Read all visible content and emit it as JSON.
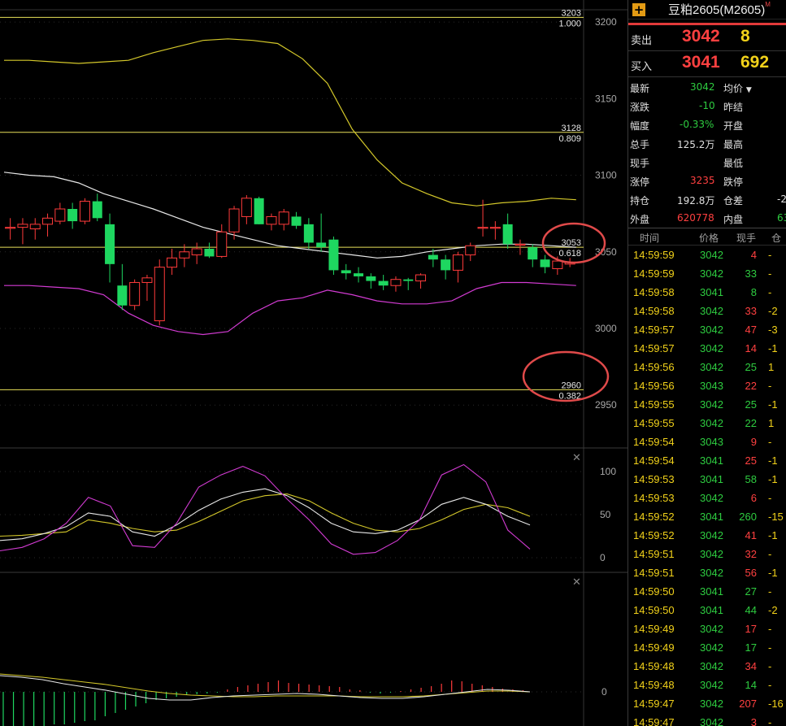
{
  "instrument": {
    "title": "豆粕2605(M2605)",
    "superscript": "M"
  },
  "bid_ask": {
    "sell": {
      "label": "卖出",
      "price": "3042",
      "volume": "8"
    },
    "buy": {
      "label": "买入",
      "price": "3041",
      "volume": "692"
    }
  },
  "stats": {
    "last": {
      "label": "最新",
      "value": "3042"
    },
    "avg_label": "均价",
    "change": {
      "label": "涨跌",
      "value": "-10"
    },
    "prev_settle_label": "昨结",
    "pct": {
      "label": "幅度",
      "value": "-0.33%"
    },
    "open_label": "开盘",
    "volume": {
      "label": "总手",
      "value": "125.2万"
    },
    "high_label": "最高",
    "current_label": "现手",
    "low_label": "最低",
    "limit_up": {
      "label": "涨停",
      "value": "3235"
    },
    "limit_down_label": "跌停",
    "open_interest": {
      "label": "持仓",
      "value": "192.8万"
    },
    "oi_diff": {
      "label": "仓差",
      "value": "-2"
    },
    "outer": {
      "label": "外盘",
      "value": "620778"
    },
    "inner": {
      "label": "内盘",
      "value": "63"
    }
  },
  "ticks_header": {
    "time": "时间",
    "price": "价格",
    "vol": "现手",
    "oi": "仓"
  },
  "ticks": [
    {
      "time": "14:59:59",
      "price": "3042",
      "price_color": "green",
      "vol": "4",
      "vol_color": "red",
      "oi": "-"
    },
    {
      "time": "14:59:59",
      "price": "3042",
      "price_color": "green",
      "vol": "33",
      "vol_color": "green",
      "oi": "-"
    },
    {
      "time": "14:59:58",
      "price": "3041",
      "price_color": "green",
      "vol": "8",
      "vol_color": "green",
      "oi": "-"
    },
    {
      "time": "14:59:58",
      "price": "3042",
      "price_color": "green",
      "vol": "33",
      "vol_color": "red",
      "oi": "-2"
    },
    {
      "time": "14:59:57",
      "price": "3042",
      "price_color": "green",
      "vol": "47",
      "vol_color": "red",
      "oi": "-3"
    },
    {
      "time": "14:59:57",
      "price": "3042",
      "price_color": "green",
      "vol": "14",
      "vol_color": "red",
      "oi": "-1"
    },
    {
      "time": "14:59:56",
      "price": "3042",
      "price_color": "green",
      "vol": "25",
      "vol_color": "green",
      "oi": "1"
    },
    {
      "time": "14:59:56",
      "price": "3043",
      "price_color": "green",
      "vol": "22",
      "vol_color": "red",
      "oi": "-"
    },
    {
      "time": "14:59:55",
      "price": "3042",
      "price_color": "green",
      "vol": "25",
      "vol_color": "green",
      "oi": "-1"
    },
    {
      "time": "14:59:55",
      "price": "3042",
      "price_color": "green",
      "vol": "22",
      "vol_color": "green",
      "oi": "1"
    },
    {
      "time": "14:59:54",
      "price": "3043",
      "price_color": "green",
      "vol": "9",
      "vol_color": "red",
      "oi": "-"
    },
    {
      "time": "14:59:54",
      "price": "3041",
      "price_color": "green",
      "vol": "25",
      "vol_color": "red",
      "oi": "-1"
    },
    {
      "time": "14:59:53",
      "price": "3041",
      "price_color": "green",
      "vol": "58",
      "vol_color": "green",
      "oi": "-1"
    },
    {
      "time": "14:59:53",
      "price": "3042",
      "price_color": "green",
      "vol": "6",
      "vol_color": "red",
      "oi": "-"
    },
    {
      "time": "14:59:52",
      "price": "3041",
      "price_color": "green",
      "vol": "260",
      "vol_color": "green",
      "oi": "-15"
    },
    {
      "time": "14:59:52",
      "price": "3042",
      "price_color": "green",
      "vol": "41",
      "vol_color": "red",
      "oi": "-1"
    },
    {
      "time": "14:59:51",
      "price": "3042",
      "price_color": "green",
      "vol": "32",
      "vol_color": "red",
      "oi": "-"
    },
    {
      "time": "14:59:51",
      "price": "3042",
      "price_color": "green",
      "vol": "56",
      "vol_color": "red",
      "oi": "-1"
    },
    {
      "time": "14:59:50",
      "price": "3041",
      "price_color": "green",
      "vol": "27",
      "vol_color": "green",
      "oi": "-"
    },
    {
      "time": "14:59:50",
      "price": "3041",
      "price_color": "green",
      "vol": "44",
      "vol_color": "green",
      "oi": "-2"
    },
    {
      "time": "14:59:49",
      "price": "3042",
      "price_color": "green",
      "vol": "17",
      "vol_color": "red",
      "oi": "-"
    },
    {
      "time": "14:59:49",
      "price": "3042",
      "price_color": "green",
      "vol": "17",
      "vol_color": "green",
      "oi": "-"
    },
    {
      "time": "14:59:48",
      "price": "3042",
      "price_color": "green",
      "vol": "34",
      "vol_color": "red",
      "oi": "-"
    },
    {
      "time": "14:59:48",
      "price": "3042",
      "price_color": "green",
      "vol": "14",
      "vol_color": "green",
      "oi": "-"
    },
    {
      "time": "14:59:47",
      "price": "3042",
      "price_color": "green",
      "vol": "207",
      "vol_color": "red",
      "oi": "-16"
    },
    {
      "time": "14:59:47",
      "price": "3042",
      "price_color": "green",
      "vol": "3",
      "vol_color": "red",
      "oi": "-"
    }
  ],
  "chart_data": {
    "type": "candlestick",
    "price_axis": {
      "ticks": [
        3200,
        3150,
        3100,
        3050,
        3000,
        2950
      ],
      "range": [
        2922,
        3208
      ]
    },
    "fib_levels": [
      {
        "price": "3203",
        "ratio": "1.000"
      },
      {
        "price": "3128",
        "ratio": "0.809"
      },
      {
        "price": "3053",
        "ratio": "0.618"
      },
      {
        "price": "2960",
        "ratio": "0.382"
      }
    ],
    "candles": [
      {
        "o": 3066,
        "h": 3072,
        "l": 3058,
        "c": 3066
      },
      {
        "o": 3066,
        "h": 3072,
        "l": 3055,
        "c": 3068
      },
      {
        "o": 3065,
        "h": 3072,
        "l": 3058,
        "c": 3068
      },
      {
        "o": 3068,
        "h": 3075,
        "l": 3060,
        "c": 3072
      },
      {
        "o": 3070,
        "h": 3082,
        "l": 3068,
        "c": 3078
      },
      {
        "o": 3078,
        "h": 3082,
        "l": 3065,
        "c": 3070
      },
      {
        "o": 3070,
        "h": 3085,
        "l": 3068,
        "c": 3083
      },
      {
        "o": 3083,
        "h": 3088,
        "l": 3070,
        "c": 3072
      },
      {
        "o": 3068,
        "h": 3075,
        "l": 3030,
        "c": 3042
      },
      {
        "o": 3028,
        "h": 3042,
        "l": 3012,
        "c": 3015
      },
      {
        "o": 3015,
        "h": 3032,
        "l": 3012,
        "c": 3030
      },
      {
        "o": 3030,
        "h": 3035,
        "l": 3018,
        "c": 3033
      },
      {
        "o": 3005,
        "h": 3045,
        "l": 3002,
        "c": 3040
      },
      {
        "o": 3040,
        "h": 3052,
        "l": 3035,
        "c": 3046
      },
      {
        "o": 3046,
        "h": 3055,
        "l": 3040,
        "c": 3050
      },
      {
        "o": 3048,
        "h": 3056,
        "l": 3042,
        "c": 3052
      },
      {
        "o": 3052,
        "h": 3056,
        "l": 3046,
        "c": 3047
      },
      {
        "o": 3047,
        "h": 3068,
        "l": 3046,
        "c": 3063
      },
      {
        "o": 3063,
        "h": 3080,
        "l": 3058,
        "c": 3078
      },
      {
        "o": 3073,
        "h": 3087,
        "l": 3068,
        "c": 3085
      },
      {
        "o": 3085,
        "h": 3086,
        "l": 3068,
        "c": 3068
      },
      {
        "o": 3068,
        "h": 3075,
        "l": 3064,
        "c": 3073
      },
      {
        "o": 3068,
        "h": 3078,
        "l": 3064,
        "c": 3076
      },
      {
        "o": 3073,
        "h": 3076,
        "l": 3065,
        "c": 3067
      },
      {
        "o": 3068,
        "h": 3072,
        "l": 3052,
        "c": 3056
      },
      {
        "o": 3056,
        "h": 3075,
        "l": 3050,
        "c": 3053
      },
      {
        "o": 3058,
        "h": 3060,
        "l": 3035,
        "c": 3038
      },
      {
        "o": 3038,
        "h": 3042,
        "l": 3032,
        "c": 3036
      },
      {
        "o": 3036,
        "h": 3040,
        "l": 3030,
        "c": 3034
      },
      {
        "o": 3034,
        "h": 3036,
        "l": 3026,
        "c": 3031
      },
      {
        "o": 3031,
        "h": 3035,
        "l": 3025,
        "c": 3028
      },
      {
        "o": 3028,
        "h": 3034,
        "l": 3024,
        "c": 3032
      },
      {
        "o": 3032,
        "h": 3033,
        "l": 3025,
        "c": 3031
      },
      {
        "o": 3031,
        "h": 3036,
        "l": 3026,
        "c": 3035
      },
      {
        "o": 3048,
        "h": 3052,
        "l": 3040,
        "c": 3045
      },
      {
        "o": 3045,
        "h": 3048,
        "l": 3032,
        "c": 3038
      },
      {
        "o": 3038,
        "h": 3050,
        "l": 3030,
        "c": 3048
      },
      {
        "o": 3048,
        "h": 3056,
        "l": 3044,
        "c": 3054
      },
      {
        "o": 3066,
        "h": 3084,
        "l": 3060,
        "c": 3066
      },
      {
        "o": 3066,
        "h": 3070,
        "l": 3058,
        "c": 3066
      },
      {
        "o": 3068,
        "h": 3075,
        "l": 3052,
        "c": 3055
      },
      {
        "o": 3055,
        "h": 3058,
        "l": 3048,
        "c": 3055
      },
      {
        "o": 3053,
        "h": 3055,
        "l": 3040,
        "c": 3045
      },
      {
        "o": 3045,
        "h": 3048,
        "l": 3036,
        "c": 3040
      },
      {
        "o": 3039,
        "h": 3047,
        "l": 3035,
        "c": 3044
      },
      {
        "o": 3042,
        "h": 3046,
        "l": 3040,
        "c": 3043
      }
    ],
    "bands": {
      "upper": [
        3175,
        3175,
        3174,
        3173,
        3174,
        3175,
        3180,
        3184,
        3188,
        3189,
        3188,
        3186,
        3176,
        3160,
        3130,
        3110,
        3095,
        3088,
        3082,
        3080,
        3082,
        3083,
        3085,
        3084
      ],
      "middle": [
        3102,
        3100,
        3099,
        3095,
        3088,
        3083,
        3078,
        3072,
        3066,
        3062,
        3058,
        3054,
        3052,
        3050,
        3048,
        3046,
        3047,
        3050,
        3052,
        3054,
        3055,
        3055,
        3054,
        3053
      ],
      "lower": [
        3028,
        3028,
        3027,
        3026,
        3022,
        3010,
        3002,
        2998,
        2996,
        2998,
        3010,
        3018,
        3020,
        3025,
        3022,
        3018,
        3016,
        3016,
        3018,
        3026,
        3030,
        3030,
        3029,
        3028
      ]
    },
    "kdj": {
      "axis_ticks": [
        100,
        50,
        0
      ],
      "K": [
        20,
        22,
        28,
        36,
        52,
        48,
        30,
        25,
        38,
        55,
        68,
        76,
        80,
        72,
        58,
        40,
        30,
        28,
        32,
        44,
        62,
        70,
        62,
        48,
        38
      ],
      "D": [
        25,
        26,
        28,
        30,
        44,
        40,
        34,
        30,
        32,
        42,
        54,
        66,
        72,
        74,
        66,
        52,
        40,
        32,
        30,
        34,
        44,
        56,
        62,
        58,
        48
      ],
      "J": [
        8,
        12,
        22,
        40,
        70,
        60,
        14,
        12,
        40,
        82,
        96,
        106,
        95,
        68,
        44,
        16,
        4,
        6,
        20,
        44,
        96,
        108,
        88,
        32,
        10
      ]
    },
    "macd": {
      "axis_ticks": [
        0
      ],
      "hist": [
        -48,
        -48,
        -45,
        -44,
        -42,
        -40,
        -40,
        -38,
        -36,
        -35,
        -30,
        -26,
        -22,
        -18,
        -14,
        -10,
        -8,
        -6,
        -4,
        -3,
        -2,
        -1,
        3,
        6,
        8,
        10,
        12,
        14,
        11,
        10,
        9,
        8,
        7,
        6,
        3,
        2,
        -1,
        -2,
        -1,
        1,
        3,
        5,
        7,
        10,
        14,
        13,
        10,
        8,
        6,
        4,
        3,
        2
      ],
      "dif": [
        20,
        18,
        15,
        10,
        6,
        2,
        -3,
        -8,
        -10,
        -10,
        -7,
        -5,
        -4,
        -3,
        -2,
        -3,
        -5,
        -7,
        -8,
        -8,
        -6,
        -3,
        0,
        3,
        2,
        0
      ],
      "dea": [
        22,
        20,
        18,
        15,
        12,
        9,
        5,
        1,
        -2,
        -4,
        -5,
        -6,
        -6,
        -5,
        -5,
        -5,
        -5,
        -6,
        -6,
        -6,
        -5,
        -3,
        -1,
        1,
        1,
        0
      ]
    }
  }
}
